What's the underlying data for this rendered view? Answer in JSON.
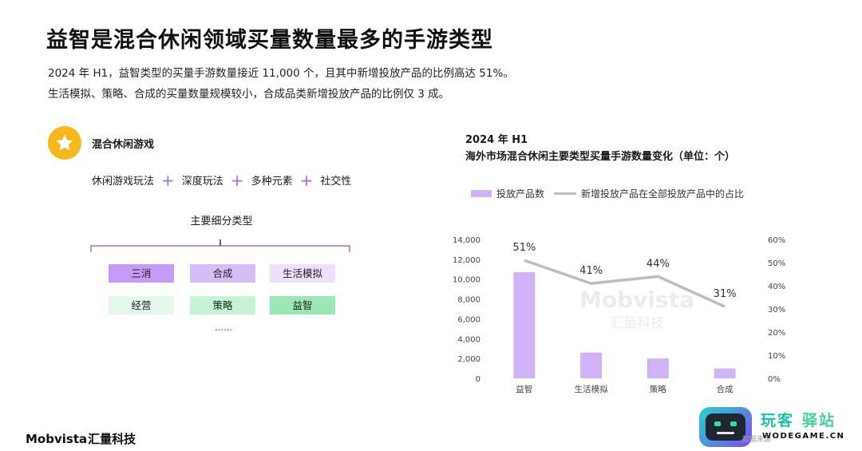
{
  "title": "益智是混合休闲领域买量数量最多的手游类型",
  "description": [
    "2024 年 H1，益智类型的买量手游数量接近 11,000 个，且其中新增投放产品的比例高达 51%。",
    "生活模拟、策略、合成的买量数量规模较小，合成品类新增投放产品的比例仅 3 成。"
  ],
  "left_panel": {
    "icon": "star-icon",
    "heading": "混合休闲游戏",
    "features": [
      "休闲游戏玩法",
      "深度玩法",
      "多种元素",
      "社交性"
    ],
    "subtypes_title": "主要细分类型",
    "subtypes": [
      {
        "label": "三消",
        "color": "#c69bf5"
      },
      {
        "label": "合成",
        "color": "#d7bdf6"
      },
      {
        "label": "生活模拟",
        "color": "#ece0fb"
      },
      {
        "label": "经营",
        "color": "#e3f8ea"
      },
      {
        "label": "策略",
        "color": "#c6f3d3"
      },
      {
        "label": "益智",
        "color": "#9ce8b5"
      }
    ],
    "more": "……"
  },
  "chart_title_line1": "2024 年 H1",
  "chart_title_line2": "海外市场混合休闲主要类型买量手游数量变化（单位：个）",
  "chart_data": {
    "type": "bar",
    "categories": [
      "益智",
      "生活模拟",
      "策略",
      "合成"
    ],
    "series": [
      {
        "name": "投放产品数",
        "type": "bar",
        "axis": "left",
        "values": [
          10700,
          2600,
          2000,
          1000
        ],
        "color": "#cfb2f7"
      },
      {
        "name": "新增投放产品在全部投放产品中的占比",
        "type": "line",
        "axis": "right",
        "values": [
          51,
          41,
          44,
          31
        ],
        "labels": [
          "51%",
          "41%",
          "44%",
          "31%"
        ],
        "color": "#bdbdbd"
      }
    ],
    "y_left": {
      "min": 0,
      "max": 14000,
      "ticks": [
        "0",
        "2,000",
        "4,000",
        "6,000",
        "8,000",
        "10,000",
        "12,000",
        "14,000"
      ]
    },
    "y_right": {
      "min": 0,
      "max": 60,
      "ticks": [
        "0%",
        "10%",
        "20%",
        "30%",
        "40%",
        "50%",
        "60%"
      ]
    },
    "legend_position": "top-left",
    "grid": false
  },
  "chart_watermark": [
    "Mobvista",
    "汇量科技"
  ],
  "brand": {
    "latin": "Mobvista",
    "cn": "汇量科技"
  },
  "site_watermark": {
    "cn1": "玩客",
    "cn2": "驿站",
    "domain": "WODEGAME.CN",
    "faint": "数据来源"
  }
}
